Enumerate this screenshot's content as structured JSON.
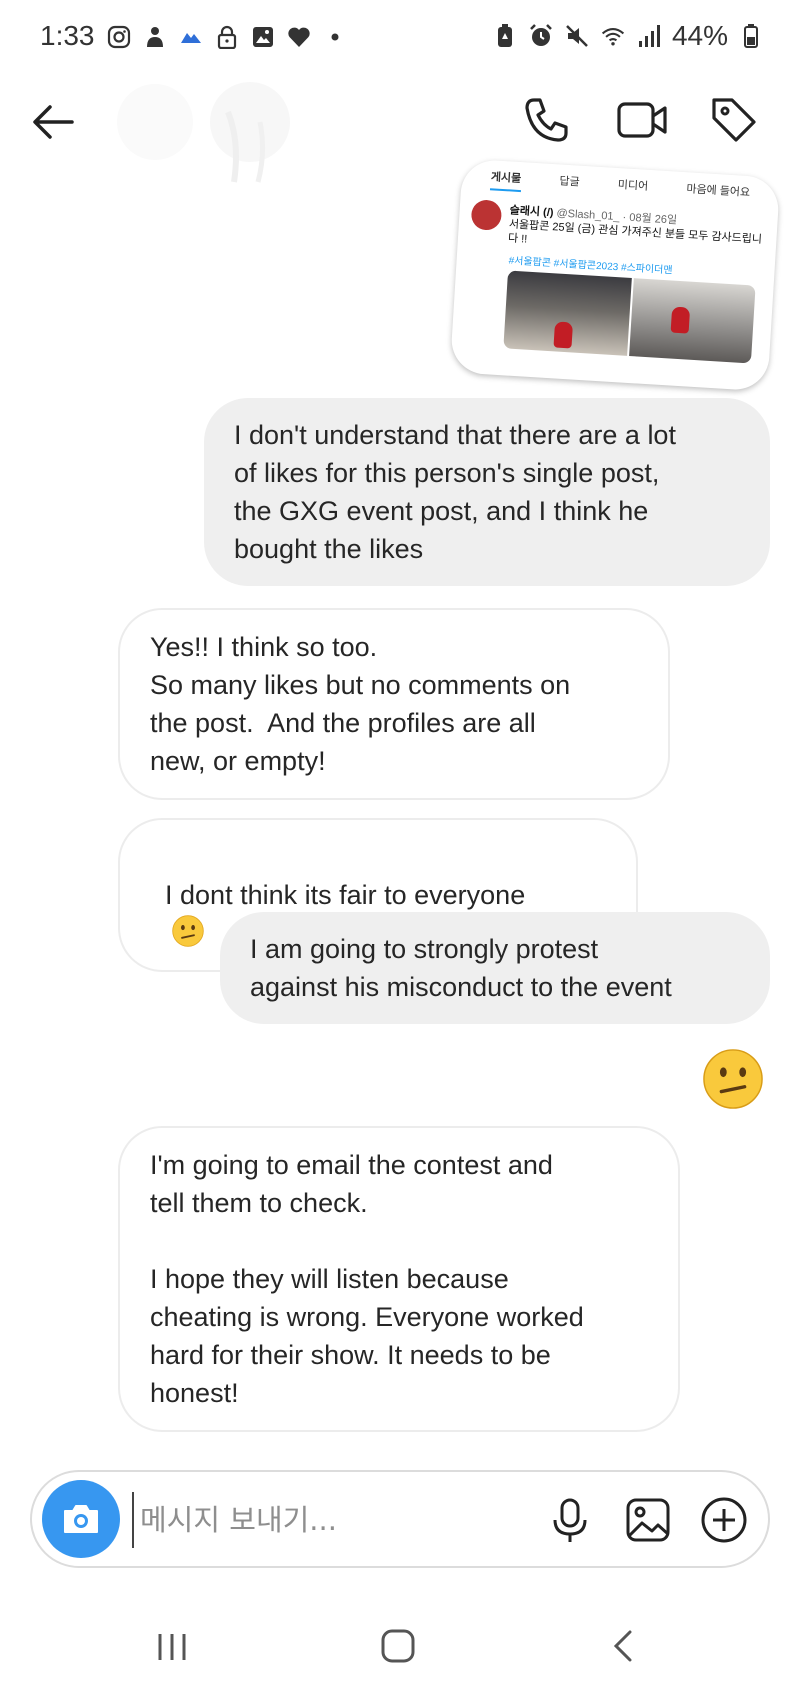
{
  "status_bar": {
    "time": "1:33",
    "battery": "44%",
    "left_icons": [
      "instagram-icon",
      "notification-icon",
      "cloud-icon",
      "lock-icon",
      "gallery-icon",
      "heart-icon",
      "dot-icon"
    ],
    "right_icons": [
      "battery-saver-icon",
      "alarm-icon",
      "mute-icon",
      "wifi-icon",
      "signal-icon",
      "battery-icon"
    ]
  },
  "header": {
    "back_icon": "arrow-left-icon",
    "actions": [
      "phone-icon",
      "video-icon",
      "tag-icon"
    ]
  },
  "shared_post": {
    "tabs": [
      "게시물",
      "답글",
      "미디어",
      "마음에 들어요"
    ],
    "author": "슬래시 (/)",
    "handle": "@Slash_01_ · 08월 26일",
    "text": "서울팝콘 25일 (금) 관심 가져주신 분들 모두 감사드립니다 !!",
    "hashtags": "#서울팝콘 #서울팝콘2023 #스파이더맨"
  },
  "messages": [
    {
      "id": "m1",
      "direction": "outgoing",
      "text": "I don't understand that there are a lot\nof likes for this person's single post,\nthe GXG event post, and I think he\nbought the likes"
    },
    {
      "id": "m2",
      "direction": "incoming",
      "text": "Yes!! I think so too.\nSo many likes but no comments on\nthe post.  And the profiles are all\nnew, or empty!"
    },
    {
      "id": "m3",
      "direction": "incoming",
      "text": "I dont think its fair to everyone",
      "emoji": "confused-face"
    },
    {
      "id": "m4",
      "direction": "outgoing",
      "text": "I am going to strongly protest\nagainst his misconduct to the event"
    },
    {
      "id": "m5",
      "direction": "outgoing",
      "emoji": "confused-face"
    },
    {
      "id": "m6",
      "direction": "incoming",
      "text": "I'm going to email the contest and\ntell them to check.\n\nI hope they will listen because\ncheating is wrong. Everyone worked\nhard for their show. It needs to be\nhonest!"
    }
  ],
  "composer": {
    "placeholder": "메시지 보내기...",
    "icons": [
      "camera-icon",
      "microphone-icon",
      "image-icon",
      "plus-circle-icon"
    ]
  },
  "colors": {
    "outgoing_bubble": "#efefef",
    "incoming_border": "#ececec",
    "camera_button": "#3797f0",
    "text": "#262626"
  }
}
